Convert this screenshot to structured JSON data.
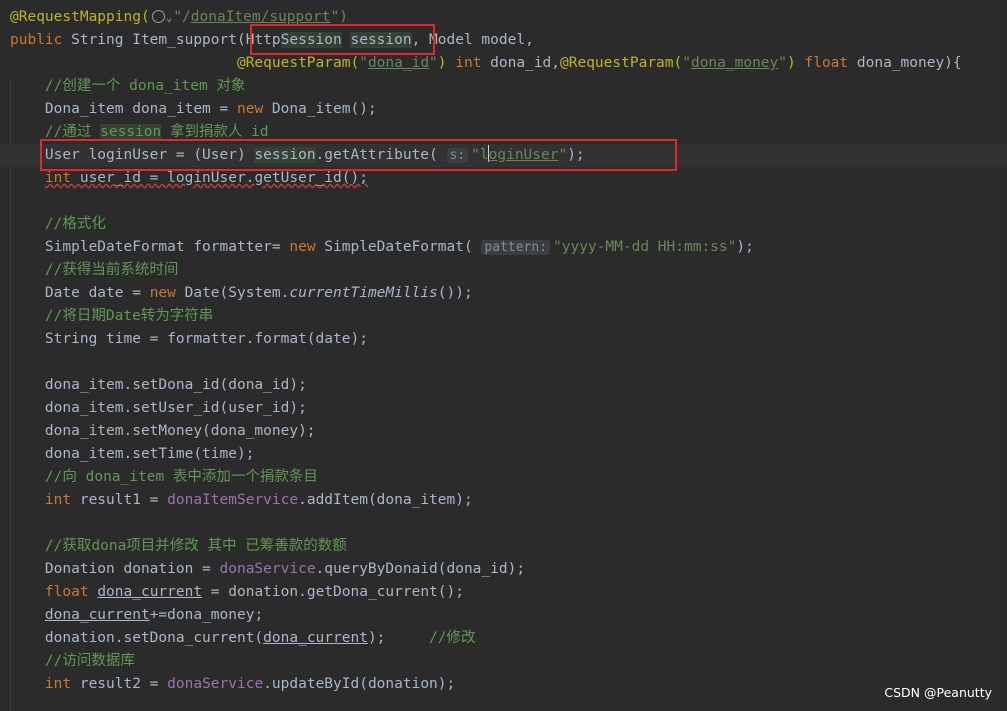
{
  "watermark": "CSDN @Peanutty",
  "lines": [
    [
      {
        "t": "@RequestMapping(",
        "c": "t-annotation"
      },
      {
        "t": "",
        "c": "t-globe"
      },
      {
        "t": "⌄",
        "c": "t-chev"
      },
      {
        "t": "\"/",
        "c": "t-string"
      },
      {
        "t": "donaItem/support",
        "c": "t-string t-under"
      },
      {
        "t": "\")",
        "c": "t-string"
      }
    ],
    [
      {
        "t": "public ",
        "c": "t-keyword"
      },
      {
        "t": "String "
      },
      {
        "t": "Item_support",
        "c": "t-method"
      },
      {
        "t": "("
      },
      {
        "t": "Http"
      },
      {
        "t": "Session",
        "c": "t-hlvar"
      },
      {
        "t": " "
      },
      {
        "t": "session",
        "c": "t-hlvar"
      },
      {
        "t": ", Model model,"
      }
    ],
    [
      {
        "t": "                          @RequestParam(",
        "c": "t-annotation"
      },
      {
        "t": "\"",
        "c": "t-string"
      },
      {
        "t": "dona_id",
        "c": "t-string t-under"
      },
      {
        "t": "\"",
        "c": "t-string"
      },
      {
        "t": ") ",
        "c": "t-annotation"
      },
      {
        "t": "int ",
        "c": "t-keyword"
      },
      {
        "t": "dona_id,"
      },
      {
        "t": "@RequestParam(",
        "c": "t-annotation"
      },
      {
        "t": "\"",
        "c": "t-string"
      },
      {
        "t": "dona_money",
        "c": "t-string t-under"
      },
      {
        "t": "\"",
        "c": "t-string"
      },
      {
        "t": ") ",
        "c": "t-annotation"
      },
      {
        "t": "float ",
        "c": "t-keyword"
      },
      {
        "t": "dona_money){"
      }
    ],
    [
      {
        "t": "    //创建一个 dona_item 对象",
        "c": "t-comment"
      }
    ],
    [
      {
        "t": "    Dona_item dona_item = "
      },
      {
        "t": "new ",
        "c": "t-keyword"
      },
      {
        "t": "Dona_item();"
      }
    ],
    [
      {
        "t": "    //通过 ",
        "c": "t-comment"
      },
      {
        "t": "session",
        "c": "t-comment t-hlvar"
      },
      {
        "t": " 拿到捐款人 id",
        "c": "t-comment"
      }
    ],
    [
      {
        "t": "    User loginUser = (User) "
      },
      {
        "t": "session",
        "c": "t-hlvar"
      },
      {
        "t": ".getAttribute( "
      },
      {
        "t": "s:",
        "c": "t-hint"
      },
      {
        "t": "\"l",
        "c": "t-string"
      },
      {
        "t": "",
        "c": "caret"
      },
      {
        "t": "oginUser",
        "c": "t-string t-under"
      },
      {
        "t": "\"",
        "c": "t-string"
      },
      {
        "t": ");"
      }
    ],
    [
      {
        "t": "    "
      },
      {
        "t": "int ",
        "c": "t-keyword t-squiggle"
      },
      {
        "t": "user_id = loginUser.getUser_id();",
        "c": "t-squiggle"
      }
    ],
    [],
    [
      {
        "t": "    //格式化",
        "c": "t-comment"
      }
    ],
    [
      {
        "t": "    SimpleDateFormat formatter= "
      },
      {
        "t": "new ",
        "c": "t-keyword"
      },
      {
        "t": "SimpleDateFormat( "
      },
      {
        "t": "pattern:",
        "c": "t-hint"
      },
      {
        "t": "\"yyyy-MM-dd HH:mm:ss\"",
        "c": "t-string"
      },
      {
        "t": ");"
      }
    ],
    [
      {
        "t": "    //获得当前系统时间",
        "c": "t-comment"
      }
    ],
    [
      {
        "t": "    Date date = "
      },
      {
        "t": "new ",
        "c": "t-keyword"
      },
      {
        "t": "Date(System."
      },
      {
        "t": "currentTimeMillis",
        "c": "t-italic"
      },
      {
        "t": "());"
      }
    ],
    [
      {
        "t": "    //将日期Date转为字符串",
        "c": "t-comment"
      }
    ],
    [
      {
        "t": "    String time = formatter.format(date);"
      }
    ],
    [],
    [
      {
        "t": "    dona_item.setDona_id(dona_id);"
      }
    ],
    [
      {
        "t": "    dona_item.setUser_id(user_id);"
      }
    ],
    [
      {
        "t": "    dona_item.setMoney(dona_money);"
      }
    ],
    [
      {
        "t": "    dona_item.setTime(time);"
      }
    ],
    [
      {
        "t": "    //向 dona_item 表中添加一个捐款条目",
        "c": "t-comment"
      }
    ],
    [
      {
        "t": "    "
      },
      {
        "t": "int ",
        "c": "t-keyword"
      },
      {
        "t": "result1 = "
      },
      {
        "t": "donaItemService",
        "c": "t-field"
      },
      {
        "t": ".addItem(dona_item);"
      }
    ],
    [],
    [
      {
        "t": "    //获取dona项目并修改 其中 已筹善款的数额",
        "c": "t-comment"
      }
    ],
    [
      {
        "t": "    Donation donation = "
      },
      {
        "t": "donaService",
        "c": "t-field"
      },
      {
        "t": ".queryByDonaid(dona_id);"
      }
    ],
    [
      {
        "t": "    "
      },
      {
        "t": "float ",
        "c": "t-keyword"
      },
      {
        "t": "dona_current",
        "c": "t-under"
      },
      {
        "t": " = donation.getDona_current();"
      }
    ],
    [
      {
        "t": "    "
      },
      {
        "t": "dona_current",
        "c": "t-under"
      },
      {
        "t": "+=dona_money;"
      }
    ],
    [
      {
        "t": "    donation.setDona_current("
      },
      {
        "t": "dona_current",
        "c": "t-under"
      },
      {
        "t": ");     "
      },
      {
        "t": "//修改",
        "c": "t-comment"
      }
    ],
    [
      {
        "t": "    //访问数据库",
        "c": "t-comment"
      }
    ],
    [
      {
        "t": "    "
      },
      {
        "t": "int ",
        "c": "t-keyword"
      },
      {
        "t": "result2 = "
      },
      {
        "t": "donaService",
        "c": "t-field"
      },
      {
        "t": ".updateById(donation);"
      }
    ]
  ]
}
